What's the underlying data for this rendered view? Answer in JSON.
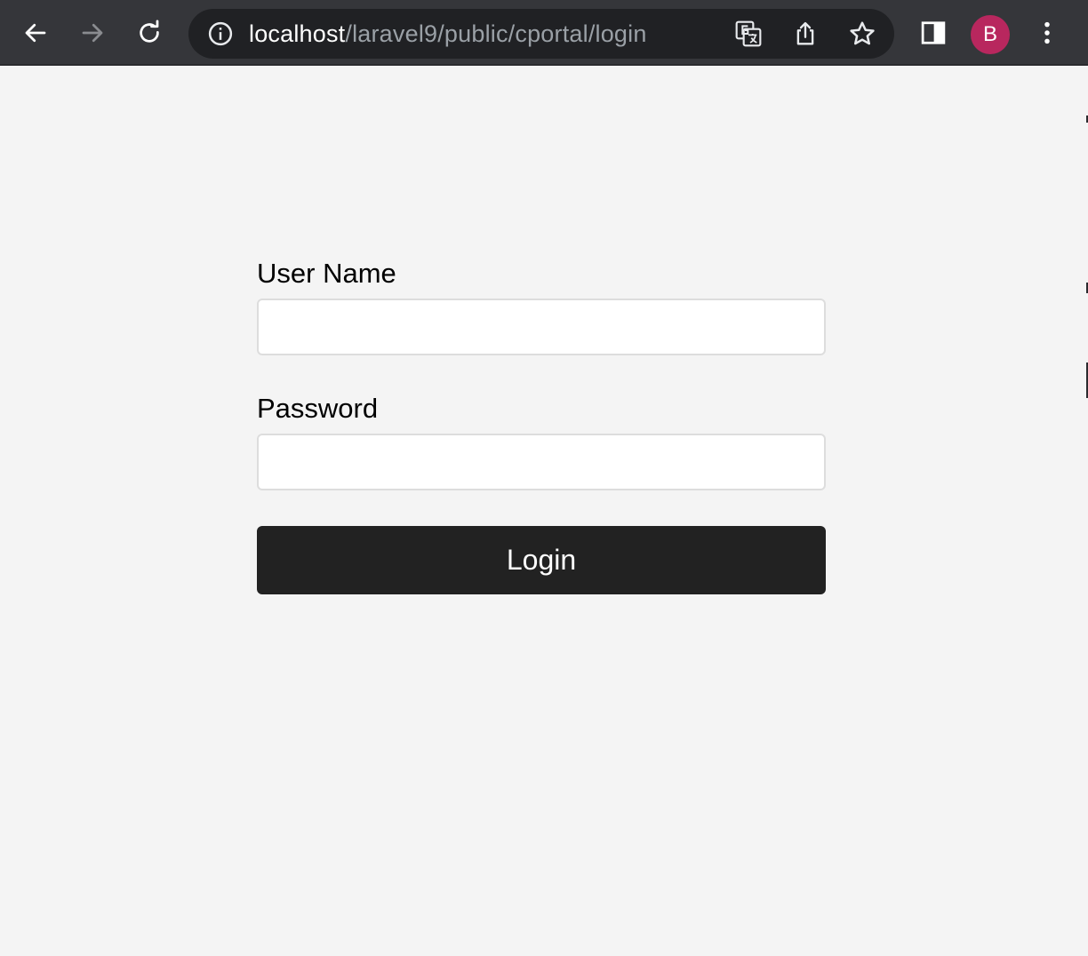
{
  "browser": {
    "url_host": "localhost",
    "url_path": "/laravel9/public/cportal/login",
    "avatar_letter": "B",
    "icons": {
      "back": "back-arrow-icon",
      "forward": "forward-arrow-icon",
      "reload": "reload-icon",
      "site_info": "info-icon",
      "translate": "translate-icon",
      "share": "share-icon",
      "bookmark": "star-icon",
      "side_panel": "side-panel-icon",
      "menu": "kebab-menu-icon"
    },
    "colors": {
      "toolbar": "#35363a",
      "omnibox": "#202124",
      "avatar": "#b8275e"
    }
  },
  "login_form": {
    "username_label": "User Name",
    "username_value": "",
    "password_label": "Password",
    "password_value": "",
    "submit_label": "Login",
    "colors": {
      "page_background": "#f4f4f4",
      "button_background": "#222222",
      "button_text": "#ffffff"
    }
  }
}
